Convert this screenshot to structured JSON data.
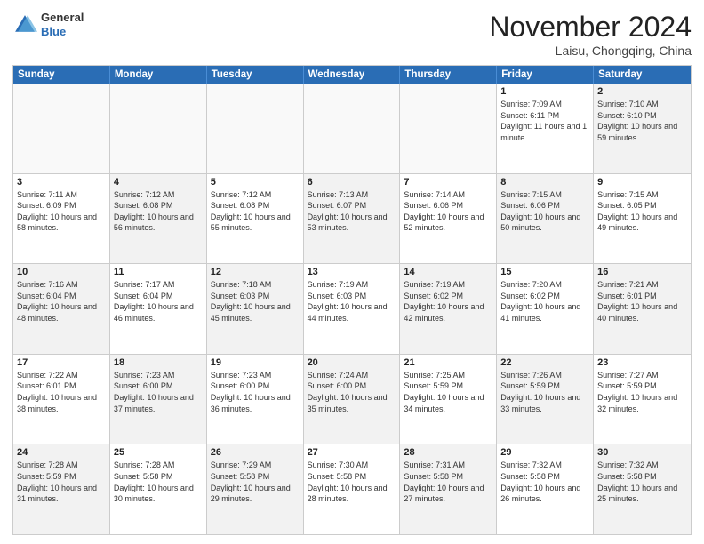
{
  "header": {
    "logo": {
      "general": "General",
      "blue": "Blue"
    },
    "title": "November 2024",
    "subtitle": "Laisu, Chongqing, China"
  },
  "days_of_week": [
    "Sunday",
    "Monday",
    "Tuesday",
    "Wednesday",
    "Thursday",
    "Friday",
    "Saturday"
  ],
  "rows": [
    {
      "cells": [
        {
          "day": "",
          "empty": true
        },
        {
          "day": "",
          "empty": true
        },
        {
          "day": "",
          "empty": true
        },
        {
          "day": "",
          "empty": true
        },
        {
          "day": "",
          "empty": true
        },
        {
          "day": "1",
          "sunrise": "Sunrise: 7:09 AM",
          "sunset": "Sunset: 6:11 PM",
          "daylight": "Daylight: 11 hours and 1 minute."
        },
        {
          "day": "2",
          "sunrise": "Sunrise: 7:10 AM",
          "sunset": "Sunset: 6:10 PM",
          "daylight": "Daylight: 10 hours and 59 minutes.",
          "shaded": true
        }
      ]
    },
    {
      "cells": [
        {
          "day": "3",
          "sunrise": "Sunrise: 7:11 AM",
          "sunset": "Sunset: 6:09 PM",
          "daylight": "Daylight: 10 hours and 58 minutes."
        },
        {
          "day": "4",
          "sunrise": "Sunrise: 7:12 AM",
          "sunset": "Sunset: 6:08 PM",
          "daylight": "Daylight: 10 hours and 56 minutes.",
          "shaded": true
        },
        {
          "day": "5",
          "sunrise": "Sunrise: 7:12 AM",
          "sunset": "Sunset: 6:08 PM",
          "daylight": "Daylight: 10 hours and 55 minutes."
        },
        {
          "day": "6",
          "sunrise": "Sunrise: 7:13 AM",
          "sunset": "Sunset: 6:07 PM",
          "daylight": "Daylight: 10 hours and 53 minutes.",
          "shaded": true
        },
        {
          "day": "7",
          "sunrise": "Sunrise: 7:14 AM",
          "sunset": "Sunset: 6:06 PM",
          "daylight": "Daylight: 10 hours and 52 minutes."
        },
        {
          "day": "8",
          "sunrise": "Sunrise: 7:15 AM",
          "sunset": "Sunset: 6:06 PM",
          "daylight": "Daylight: 10 hours and 50 minutes.",
          "shaded": true
        },
        {
          "day": "9",
          "sunrise": "Sunrise: 7:15 AM",
          "sunset": "Sunset: 6:05 PM",
          "daylight": "Daylight: 10 hours and 49 minutes."
        }
      ]
    },
    {
      "cells": [
        {
          "day": "10",
          "sunrise": "Sunrise: 7:16 AM",
          "sunset": "Sunset: 6:04 PM",
          "daylight": "Daylight: 10 hours and 48 minutes.",
          "shaded": true
        },
        {
          "day": "11",
          "sunrise": "Sunrise: 7:17 AM",
          "sunset": "Sunset: 6:04 PM",
          "daylight": "Daylight: 10 hours and 46 minutes."
        },
        {
          "day": "12",
          "sunrise": "Sunrise: 7:18 AM",
          "sunset": "Sunset: 6:03 PM",
          "daylight": "Daylight: 10 hours and 45 minutes.",
          "shaded": true
        },
        {
          "day": "13",
          "sunrise": "Sunrise: 7:19 AM",
          "sunset": "Sunset: 6:03 PM",
          "daylight": "Daylight: 10 hours and 44 minutes."
        },
        {
          "day": "14",
          "sunrise": "Sunrise: 7:19 AM",
          "sunset": "Sunset: 6:02 PM",
          "daylight": "Daylight: 10 hours and 42 minutes.",
          "shaded": true
        },
        {
          "day": "15",
          "sunrise": "Sunrise: 7:20 AM",
          "sunset": "Sunset: 6:02 PM",
          "daylight": "Daylight: 10 hours and 41 minutes."
        },
        {
          "day": "16",
          "sunrise": "Sunrise: 7:21 AM",
          "sunset": "Sunset: 6:01 PM",
          "daylight": "Daylight: 10 hours and 40 minutes.",
          "shaded": true
        }
      ]
    },
    {
      "cells": [
        {
          "day": "17",
          "sunrise": "Sunrise: 7:22 AM",
          "sunset": "Sunset: 6:01 PM",
          "daylight": "Daylight: 10 hours and 38 minutes."
        },
        {
          "day": "18",
          "sunrise": "Sunrise: 7:23 AM",
          "sunset": "Sunset: 6:00 PM",
          "daylight": "Daylight: 10 hours and 37 minutes.",
          "shaded": true
        },
        {
          "day": "19",
          "sunrise": "Sunrise: 7:23 AM",
          "sunset": "Sunset: 6:00 PM",
          "daylight": "Daylight: 10 hours and 36 minutes."
        },
        {
          "day": "20",
          "sunrise": "Sunrise: 7:24 AM",
          "sunset": "Sunset: 6:00 PM",
          "daylight": "Daylight: 10 hours and 35 minutes.",
          "shaded": true
        },
        {
          "day": "21",
          "sunrise": "Sunrise: 7:25 AM",
          "sunset": "Sunset: 5:59 PM",
          "daylight": "Daylight: 10 hours and 34 minutes."
        },
        {
          "day": "22",
          "sunrise": "Sunrise: 7:26 AM",
          "sunset": "Sunset: 5:59 PM",
          "daylight": "Daylight: 10 hours and 33 minutes.",
          "shaded": true
        },
        {
          "day": "23",
          "sunrise": "Sunrise: 7:27 AM",
          "sunset": "Sunset: 5:59 PM",
          "daylight": "Daylight: 10 hours and 32 minutes."
        }
      ]
    },
    {
      "cells": [
        {
          "day": "24",
          "sunrise": "Sunrise: 7:28 AM",
          "sunset": "Sunset: 5:59 PM",
          "daylight": "Daylight: 10 hours and 31 minutes.",
          "shaded": true
        },
        {
          "day": "25",
          "sunrise": "Sunrise: 7:28 AM",
          "sunset": "Sunset: 5:58 PM",
          "daylight": "Daylight: 10 hours and 30 minutes."
        },
        {
          "day": "26",
          "sunrise": "Sunrise: 7:29 AM",
          "sunset": "Sunset: 5:58 PM",
          "daylight": "Daylight: 10 hours and 29 minutes.",
          "shaded": true
        },
        {
          "day": "27",
          "sunrise": "Sunrise: 7:30 AM",
          "sunset": "Sunset: 5:58 PM",
          "daylight": "Daylight: 10 hours and 28 minutes."
        },
        {
          "day": "28",
          "sunrise": "Sunrise: 7:31 AM",
          "sunset": "Sunset: 5:58 PM",
          "daylight": "Daylight: 10 hours and 27 minutes.",
          "shaded": true
        },
        {
          "day": "29",
          "sunrise": "Sunrise: 7:32 AM",
          "sunset": "Sunset: 5:58 PM",
          "daylight": "Daylight: 10 hours and 26 minutes."
        },
        {
          "day": "30",
          "sunrise": "Sunrise: 7:32 AM",
          "sunset": "Sunset: 5:58 PM",
          "daylight": "Daylight: 10 hours and 25 minutes.",
          "shaded": true
        }
      ]
    }
  ]
}
